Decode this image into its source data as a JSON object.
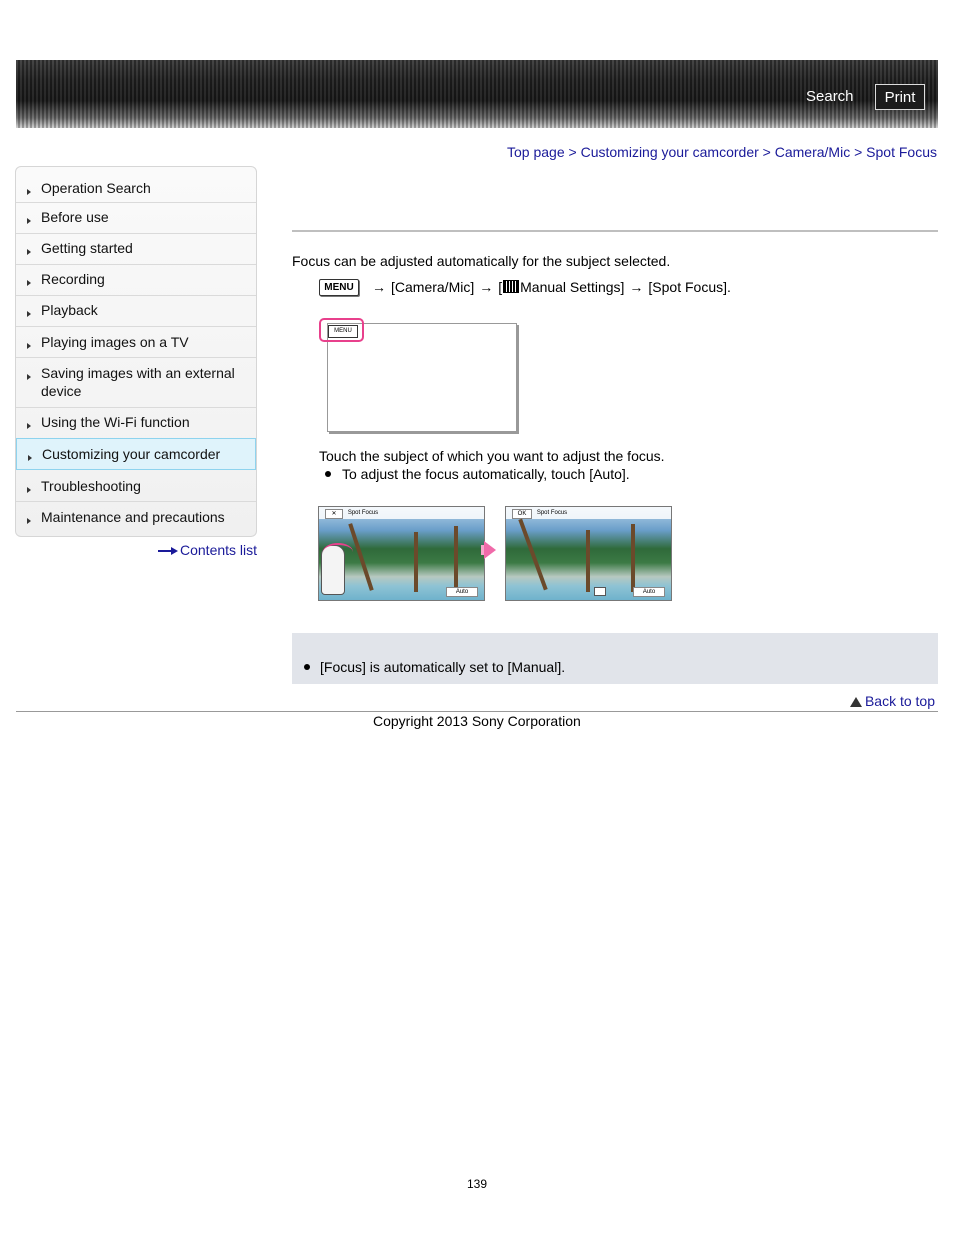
{
  "header": {
    "search_label": "Search",
    "print_label": "Print"
  },
  "breadcrumb": {
    "items": [
      "Top page",
      "Customizing your camcorder",
      "Camera/Mic",
      "Spot Focus"
    ],
    "separator": ">"
  },
  "sidebar": {
    "items": [
      {
        "label": "Operation Search"
      },
      {
        "label": "Before use"
      },
      {
        "label": "Getting started"
      },
      {
        "label": "Recording"
      },
      {
        "label": "Playback"
      },
      {
        "label": "Playing images on a TV"
      },
      {
        "label": "Saving images with an external device"
      },
      {
        "label": "Using the Wi-Fi function"
      },
      {
        "label": "Customizing your camcorder"
      },
      {
        "label": "Troubleshooting"
      },
      {
        "label": "Maintenance and precautions"
      }
    ],
    "active_index": 8,
    "contents_link": "Contents list"
  },
  "main": {
    "intro": "Focus can be adjusted automatically for the subject selected.",
    "step1": {
      "menu_icon": "MENU",
      "part1": "[Camera/Mic]",
      "part2_prefix": "[",
      "part2": "Manual Settings]",
      "part3": "[Spot Focus].",
      "arrow": "→"
    },
    "illustration_menu": "MENU",
    "step2": "Touch the subject of which you want to adjust the focus.",
    "step2_bullet": "To adjust the focus automatically, touch [Auto].",
    "photo1": {
      "close": "✕",
      "title": "Spot Focus",
      "auto": "Auto"
    },
    "photo2": {
      "ok": "OK",
      "title": "Spot Focus",
      "auto": "Auto"
    },
    "note_bullet": "[Focus] is automatically set to [Manual]."
  },
  "footer": {
    "back_to_top": "Back to top",
    "copyright": "Copyright 2013 Sony Corporation",
    "page_number": "139"
  },
  "colors": {
    "link": "#1a1a99",
    "highlight": "#e8408c",
    "note_bg": "#e1e4ea",
    "active_nav_bg": "#dff3fb"
  }
}
